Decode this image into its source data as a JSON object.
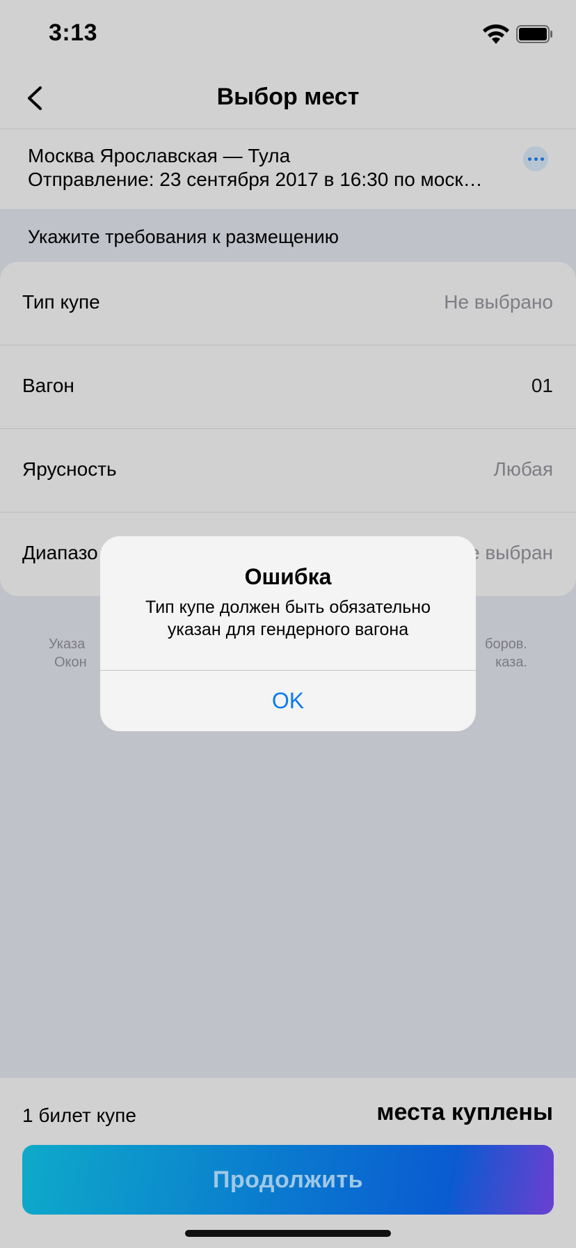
{
  "status_bar": {
    "time": "3:13"
  },
  "nav": {
    "title": "Выбор мест"
  },
  "trip": {
    "route": "Москва Ярославская — Тула",
    "departure": "Отправление: 23 сентября 2017 в 16:30  по моск…"
  },
  "requirements": {
    "header": "Укажите требования к размещению",
    "rows": [
      {
        "label": "Тип купе",
        "value": "Не выбрано"
      },
      {
        "label": "Вагон",
        "value": "01"
      },
      {
        "label": "Ярусность",
        "value": "Любая"
      },
      {
        "label": "Диапазо",
        "value": "е выбран"
      }
    ]
  },
  "hint": {
    "line1_left": "Указа",
    "line1_right": "боров.",
    "line2_left": "Окон",
    "line2_right": "каза."
  },
  "bottom": {
    "ticket_info": "1 билет купе",
    "seats_status": "места куплены",
    "continue_label": "Продолжить"
  },
  "alert": {
    "title": "Ошибка",
    "message": "Тип купе должен быть обязательно указан для гендерного вагона",
    "ok_label": "OK"
  },
  "colors": {
    "accent": "#0a7bea",
    "overlay_background": "#c0c2c9"
  }
}
